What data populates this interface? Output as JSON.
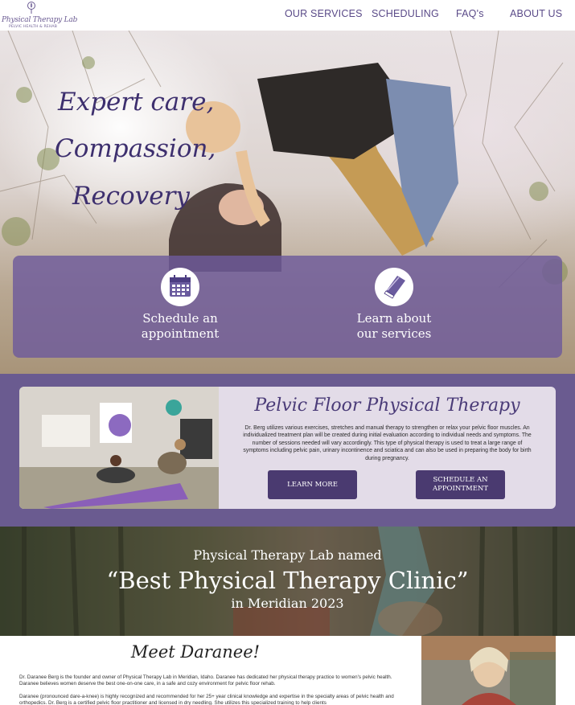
{
  "logo": {
    "title": "Physical Therapy Lab",
    "subtitle": "PELVIC HEALTH & REHAB"
  },
  "nav": {
    "items": [
      "OUR SERVICES",
      "SCHEDULING",
      "FAQ's",
      "ABOUT US"
    ]
  },
  "hero": {
    "lines": [
      "Expert care,",
      "Compassion,",
      "Recovery"
    ],
    "cta": [
      {
        "line1": "Schedule an",
        "line2": "appointment",
        "icon": "calendar-icon"
      },
      {
        "line1": "Learn about",
        "line2": "our services",
        "icon": "book-icon"
      }
    ]
  },
  "feature": {
    "title": "Pelvic Floor Physical Therapy",
    "body": "Dr. Berg utilizes various exercises, stretches and manual therapy to strengthen or relax your pelvic floor muscles. An individualized treatment plan will be created during initial evaluation according to individual needs and symptoms. The number of sessions needed will vary accordingly. This type of physical therapy is used to treat a large range of symptoms including pelvic pain, urinary incontinence and sciatica and can also be used in preparing the body for birth during pregnancy.",
    "learn_more": "LEARN MORE",
    "schedule_line1": "SCHEDULE AN",
    "schedule_line2": "APPOINTMENT"
  },
  "award": {
    "line1": "Physical Therapy Lab named",
    "line2": "“Best Physical Therapy Clinic”",
    "line3": "in Meridian 2023"
  },
  "meet": {
    "title": "Meet Daranee!",
    "p1": "Dr. Daranee Berg is the founder and owner of Physical Therapy Lab in Meridian, Idaho. Daranee has dedicated her physical therapy practice to women's pelvic health. Daranee believes women deserve the best one-on-one care, in a safe and cozy environment for pelvic floor rehab.",
    "p2": "Daranee (pronounced dare-a-knee) is highly recognized and recommended for her 25+ year clinical knowledge and expertise in the specialty areas of pelvic health and orthopedics. Dr. Berg is a certified pelvic floor practitioner and licensed in dry needling. She utilizes this specialized training to help clients"
  },
  "colors": {
    "brand_purple": "#6a5b90",
    "dark_purple": "#4a3a70",
    "text_purple": "#5a4a88"
  }
}
